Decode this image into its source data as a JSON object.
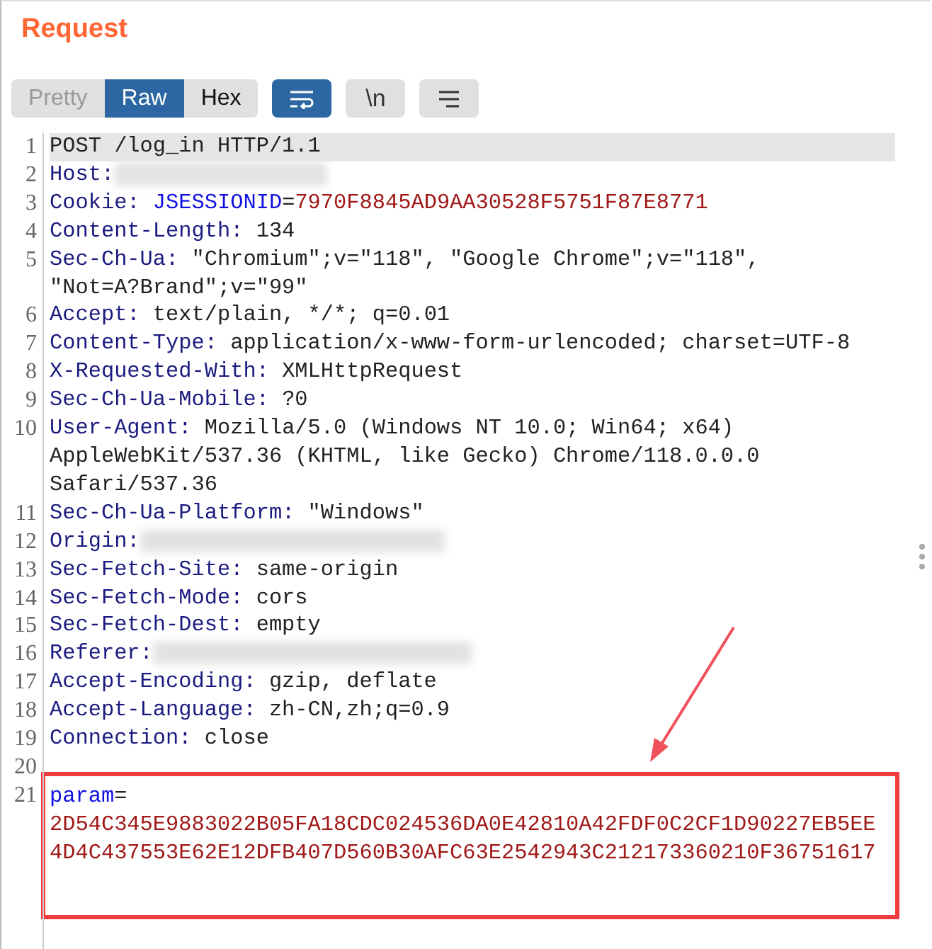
{
  "title": "Request",
  "view_tabs": [
    {
      "label": "Pretty",
      "selected": false
    },
    {
      "label": "Raw",
      "selected": true
    },
    {
      "label": "Hex",
      "selected": false
    }
  ],
  "tools": [
    {
      "kind": "wrap",
      "selected": true
    },
    {
      "kind": "newlines",
      "label": "\\n",
      "selected": false
    },
    {
      "kind": "menu",
      "selected": false
    }
  ],
  "lines": [
    {
      "number": "1",
      "highlighted": true,
      "rows": [
        [
          {
            "kind": "plain",
            "text": "POST /log_in HTTP/1.1"
          }
        ]
      ]
    },
    {
      "number": "2",
      "highlighted": false,
      "rows": [
        [
          {
            "kind": "key",
            "text": "Host:"
          },
          {
            "kind": "redacted"
          }
        ]
      ]
    },
    {
      "number": "3",
      "highlighted": false,
      "rows": [
        [
          {
            "kind": "key",
            "text": "Cookie: "
          },
          {
            "kind": "param",
            "text": "JSESSIONID"
          },
          {
            "kind": "plain",
            "text": "="
          },
          {
            "kind": "value",
            "text": "7970F8845AD9AA30528F5751F87E8771"
          }
        ]
      ]
    },
    {
      "number": "4",
      "highlighted": false,
      "rows": [
        [
          {
            "kind": "key",
            "text": "Content-Length:"
          },
          {
            "kind": "plain",
            "text": " 134"
          }
        ]
      ]
    },
    {
      "number": "5",
      "highlighted": false,
      "rows": [
        [
          {
            "kind": "key",
            "text": "Sec-Ch-Ua:"
          },
          {
            "kind": "plain",
            "text": " \"Chromium\";v=\"118\", \"Google Chrome\";v=\"118\","
          }
        ],
        [
          {
            "kind": "plain",
            "text": "\"Not=A?Brand\";v=\"99\""
          }
        ]
      ]
    },
    {
      "number": "6",
      "highlighted": false,
      "rows": [
        [
          {
            "kind": "key",
            "text": "Accept:"
          },
          {
            "kind": "plain",
            "text": " text/plain, */*; q=0.01"
          }
        ]
      ]
    },
    {
      "number": "7",
      "highlighted": false,
      "rows": [
        [
          {
            "kind": "key",
            "text": "Content-Type:"
          },
          {
            "kind": "plain",
            "text": " application/x-www-form-urlencoded; charset=UTF-8"
          }
        ]
      ]
    },
    {
      "number": "8",
      "highlighted": false,
      "rows": [
        [
          {
            "kind": "key",
            "text": "X-Requested-With:"
          },
          {
            "kind": "plain",
            "text": " XMLHttpRequest"
          }
        ]
      ]
    },
    {
      "number": "9",
      "highlighted": false,
      "rows": [
        [
          {
            "kind": "key",
            "text": "Sec-Ch-Ua-Mobile:"
          },
          {
            "kind": "plain",
            "text": " ?0"
          }
        ]
      ]
    },
    {
      "number": "10",
      "highlighted": false,
      "rows": [
        [
          {
            "kind": "key",
            "text": "User-Agent:"
          },
          {
            "kind": "plain",
            "text": " Mozilla/5.0 (Windows NT 10.0; Win64; x64)"
          }
        ],
        [
          {
            "kind": "plain",
            "text": "AppleWebKit/537.36 (KHTML, like Gecko) Chrome/118.0.0.0"
          }
        ],
        [
          {
            "kind": "plain",
            "text": "Safari/537.36"
          }
        ]
      ]
    },
    {
      "number": "11",
      "highlighted": false,
      "rows": [
        [
          {
            "kind": "key",
            "text": "Sec-Ch-Ua-Platform:"
          },
          {
            "kind": "plain",
            "text": " \"Windows\""
          }
        ]
      ]
    },
    {
      "number": "12",
      "highlighted": false,
      "rows": [
        [
          {
            "kind": "key",
            "text": "Origin:"
          },
          {
            "kind": "redacted"
          }
        ]
      ]
    },
    {
      "number": "13",
      "highlighted": false,
      "rows": [
        [
          {
            "kind": "key",
            "text": "Sec-Fetch-Site:"
          },
          {
            "kind": "plain",
            "text": " same-origin"
          }
        ]
      ]
    },
    {
      "number": "14",
      "highlighted": false,
      "rows": [
        [
          {
            "kind": "key",
            "text": "Sec-Fetch-Mode:"
          },
          {
            "kind": "plain",
            "text": " cors"
          }
        ]
      ]
    },
    {
      "number": "15",
      "highlighted": false,
      "rows": [
        [
          {
            "kind": "key",
            "text": "Sec-Fetch-Dest:"
          },
          {
            "kind": "plain",
            "text": " empty"
          }
        ]
      ]
    },
    {
      "number": "16",
      "highlighted": false,
      "rows": [
        [
          {
            "kind": "key",
            "text": "Referer:"
          },
          {
            "kind": "redacted"
          }
        ]
      ]
    },
    {
      "number": "17",
      "highlighted": false,
      "rows": [
        [
          {
            "kind": "key",
            "text": "Accept-Encoding:"
          },
          {
            "kind": "plain",
            "text": " gzip, deflate"
          }
        ]
      ]
    },
    {
      "number": "18",
      "highlighted": false,
      "rows": [
        [
          {
            "kind": "key",
            "text": "Accept-Language:"
          },
          {
            "kind": "plain",
            "text": " zh-CN,zh;q=0.9"
          }
        ]
      ]
    },
    {
      "number": "19",
      "highlighted": false,
      "rows": [
        [
          {
            "kind": "key",
            "text": "Connection:"
          },
          {
            "kind": "plain",
            "text": " close"
          }
        ]
      ]
    },
    {
      "number": "20",
      "highlighted": false,
      "rows": [
        []
      ]
    },
    {
      "number": "21",
      "highlighted": false,
      "boxed": true,
      "rows": [
        [
          {
            "kind": "param",
            "text": "param"
          },
          {
            "kind": "plain",
            "text": "="
          }
        ],
        [
          {
            "kind": "value",
            "text": "2D54C345E9883022B05FA18CDC024536DA0E42810A42FDF0C2CF1D90227EB5EE"
          }
        ],
        [
          {
            "kind": "value",
            "text": "4D4C437553E62E12DFB407D560B30AFC63E2542943C212173360210F36751617"
          }
        ]
      ]
    }
  ]
}
